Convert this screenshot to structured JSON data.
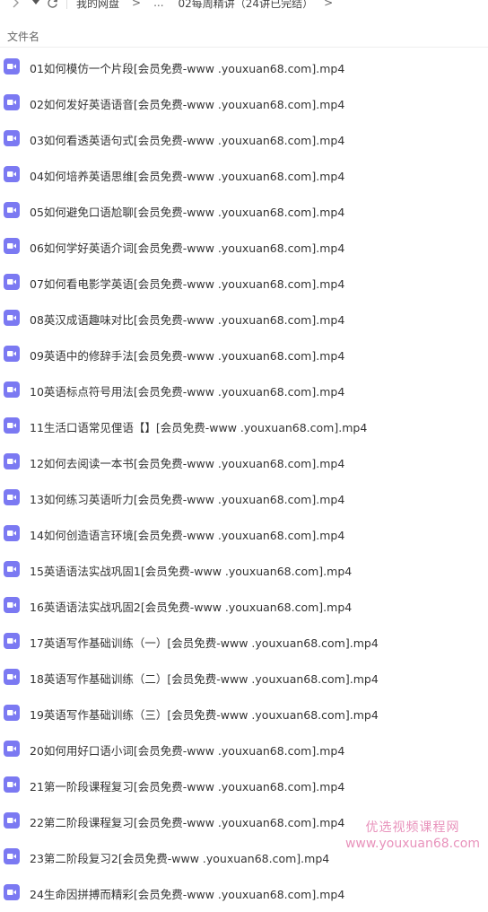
{
  "breadcrumb": {
    "items": [
      "我的网盘",
      "...",
      "02每周精讲（24讲已完结）"
    ],
    "separator": ">"
  },
  "icons": {
    "forward": "chevron-right-icon",
    "dropdown": "caret-down-icon",
    "refresh": "refresh-icon",
    "file": "video-file-icon"
  },
  "header": {
    "filename_label": "文件名"
  },
  "files": [
    "01如何模仿一个片段[会员免费-www .youxuan68.com].mp4",
    "02如何发好英语语音[会员免费-www .youxuan68.com].mp4",
    "03如何看透英语句式[会员免费-www .youxuan68.com].mp4",
    "04如何培养英语思维[会员免费-www .youxuan68.com].mp4",
    "05如何避免口语尬聊[会员免费-www .youxuan68.com].mp4",
    "06如何学好英语介词[会员免费-www .youxuan68.com].mp4",
    "07如何看电影学英语[会员免费-www .youxuan68.com].mp4",
    "08英汉成语趣味对比[会员免费-www .youxuan68.com].mp4",
    "09英语中的修辞手法[会员免费-www .youxuan68.com].mp4",
    "10英语标点符号用法[会员免费-www .youxuan68.com].mp4",
    "11生活口语常见俚语【】[会员免费-www .youxuan68.com].mp4",
    "12如何去阅读一本书[会员免费-www .youxuan68.com].mp4",
    "13如何练习英语听力[会员免费-www .youxuan68.com].mp4",
    "14如何创造语言环境[会员免费-www .youxuan68.com].mp4",
    "15英语语法实战巩固1[会员免费-www .youxuan68.com].mp4",
    "16英语语法实战巩固2[会员免费-www .youxuan68.com].mp4",
    "17英语写作基础训练（一）[会员免费-www .youxuan68.com].mp4",
    "18英语写作基础训练（二）[会员免费-www .youxuan68.com].mp4",
    "19英语写作基础训练（三）[会员免费-www .youxuan68.com].mp4",
    "20如何用好口语小词[会员免费-www .youxuan68.com].mp4",
    "21第一阶段课程复习[会员免费-www .youxuan68.com].mp4",
    "22第二阶段课程复习[会员免费-www .youxuan68.com].mp4",
    "23第二阶段复习2[会员免费-www .youxuan68.com].mp4",
    "24生命因拼搏而精彩[会员免费-www .youxuan68.com].mp4"
  ],
  "watermark": {
    "line1": "优选视频课程网",
    "line2": "www.youxuan68.com"
  },
  "colors": {
    "file_icon": "#7b79f2",
    "watermark": "#e57fb0"
  }
}
